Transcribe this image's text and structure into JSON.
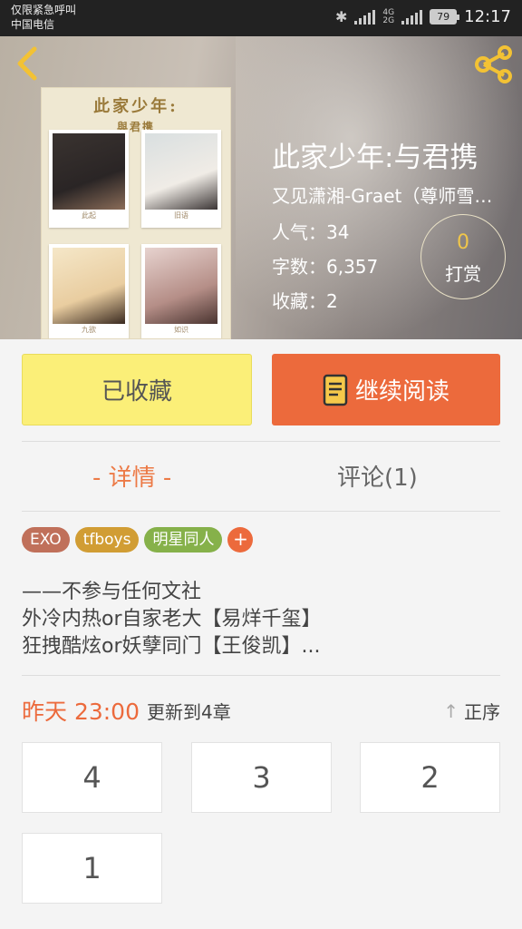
{
  "status_bar": {
    "line1": "仅限紧急呼叫",
    "line2": "中国电信",
    "network": "4G",
    "network2": "2G",
    "battery": "79",
    "time": "12:17"
  },
  "cover": {
    "title_line1": "此家少年:",
    "title_line2": "與君携",
    "captions": [
      "此起",
      "旧语",
      "九欲",
      "如识"
    ]
  },
  "book": {
    "title": "此家少年:与君携",
    "author": "又见潇湘-Graet（尊师雪落）",
    "popularity": "人气：34",
    "word_count": "字数：6,357",
    "favorites": "收藏：2"
  },
  "tip": {
    "count": "0",
    "label": "打赏"
  },
  "actions": {
    "favorited_label": "已收藏",
    "continue_label": "继续阅读"
  },
  "tabs": {
    "detail": "- 详情 -",
    "comments": "评论(1)"
  },
  "tags": [
    "EXO",
    "tfboys",
    "明星同人"
  ],
  "tag_add": "+",
  "description": [
    "——不参与任何文社",
    "外冷内热or自家老大【易烊千玺】",
    "狂拽酷炫or妖孽同门【王俊凯】..."
  ],
  "update": {
    "date": "昨天 23:00",
    "text": "更新到4章",
    "sort_label": "正序",
    "sort_icon": "↑"
  },
  "chapters": [
    "4",
    "3",
    "2",
    "1"
  ],
  "colors": {
    "accent": "#ec6a3c",
    "fav_button": "#fbef78",
    "tip_count": "#f0c64a"
  }
}
